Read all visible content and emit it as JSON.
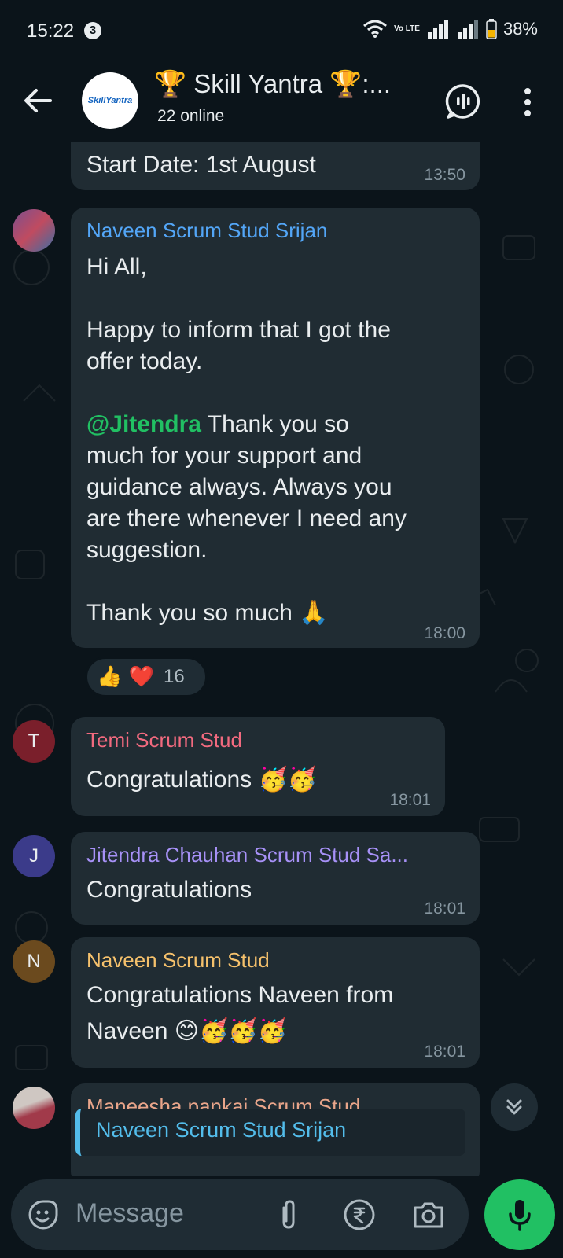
{
  "status_bar": {
    "time": "15:22",
    "notification_count": "3",
    "volte_label": "Vo LTE",
    "battery_percent": "38%"
  },
  "header": {
    "group_logo_text_1": "Skill",
    "group_logo_text_2": "Yantra",
    "title": "🏆 Skill Yantra 🏆:...",
    "subtitle": "22 online"
  },
  "messages": [
    {
      "lines": [
        "Start Date: 1st August"
      ],
      "time": "13:50"
    },
    {
      "sender": "Naveen Scrum Stud Srijan",
      "sender_color": "#53a6f7",
      "greeting": "Hi All,",
      "line_1": "Happy to inform that I got the",
      "line_2": "offer today.",
      "mention": "@Jitendra",
      "line_3": " Thank you so",
      "line_4": "much for your support and",
      "line_5": "guidance always. Always you",
      "line_6": "are there whenever I need any",
      "line_7": "suggestion.",
      "line_8": "Thank you so much 🙏",
      "time": "18:00",
      "reactions": {
        "emojis": "👍 ❤️",
        "count": "16"
      }
    },
    {
      "avatar_letter": "T",
      "avatar_color": "#7a1f2b",
      "sender": "Temi Scrum Stud",
      "sender_color": "#f26a7f",
      "text": "Congratulations 🥳🥳",
      "time": "18:01"
    },
    {
      "avatar_letter": "J",
      "avatar_color": "#3b3b8a",
      "sender": "Jitendra Chauhan Scrum Stud Sa...",
      "sender_color": "#a791f7",
      "text": "Congratulations",
      "time": "18:01"
    },
    {
      "avatar_letter": "N",
      "avatar_color": "#6b4a1e",
      "sender": "Naveen Scrum Stud",
      "sender_color": "#f5c16c",
      "line_1": "Congratulations Naveen from",
      "line_2": "Naveen 😊🥳🥳🥳",
      "time": "18:01"
    },
    {
      "sender": "Maneesha pankaj Scrum Stud",
      "sender_color": "#e9a58a",
      "quoted_sender": "Naveen Scrum Stud Srijan"
    }
  ],
  "composer": {
    "placeholder": "Message"
  },
  "colors": {
    "background": "#0b141a",
    "bubble": "#202c33",
    "accent_green": "#21c063",
    "timestamp": "#8696a0"
  }
}
